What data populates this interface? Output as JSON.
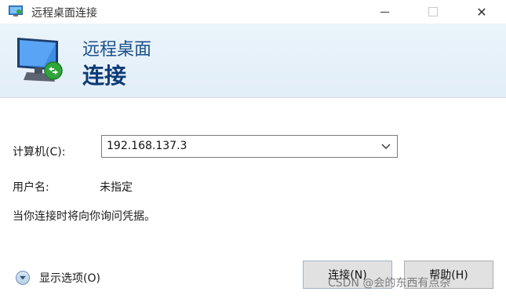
{
  "window": {
    "title": "远程桌面连接",
    "minimize_icon": "minimize-icon",
    "maximize_icon": "maximize-icon",
    "close_label": "✕"
  },
  "banner": {
    "line1": "远程桌面",
    "line2": "连接",
    "icon": "remote-desktop-monitor-icon"
  },
  "form": {
    "computer_label": "计算机(C):",
    "computer_value": "192.168.137.3",
    "user_label": "用户名:",
    "user_value": "未指定",
    "hint": "当你连接时将向你询问凭据。"
  },
  "footer": {
    "show_options": "显示选项(O)",
    "connect_button": "连接(N)",
    "help_button": "帮助(H)"
  },
  "watermark": "CSDN @会的东西有点杂",
  "colors": {
    "banner_title": "#1a4f8b",
    "banner_bg": "#e6f1fa"
  }
}
